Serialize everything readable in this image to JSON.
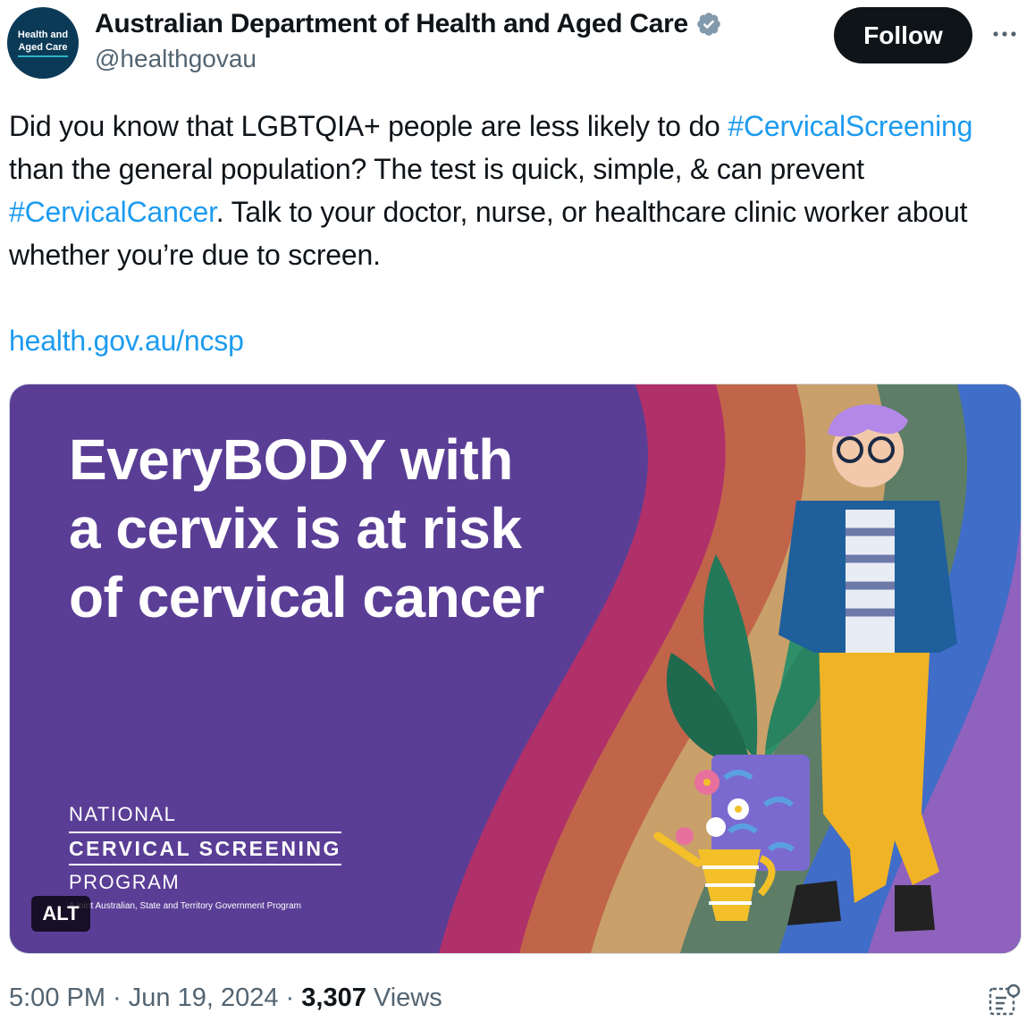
{
  "header": {
    "avatar_line1": "Health and",
    "avatar_line2": "Aged Care",
    "display_name": "Australian Department of Health and Aged Care",
    "handle": "@healthgovau",
    "follow_label": "Follow",
    "verified_icon": "verified-badge-icon",
    "more_icon": "more-options-icon"
  },
  "tweet": {
    "seg1": "Did you know that LGBTQIA+ people are less likely to do ",
    "hashtag1": "#CervicalScreening",
    "seg2": " than the general population? The test is quick, simple, & can prevent ",
    "hashtag2": "#CervicalCancer",
    "seg3": ". Talk to your doctor, nurse, or healthcare clinic worker about whether you’re due to screen.",
    "url": "health.gov.au/ncsp"
  },
  "media": {
    "headline_line1": "EveryBODY with",
    "headline_line2": "a cervix is at risk",
    "headline_line3": "of cervical cancer",
    "logo_line1": "NATIONAL",
    "logo_line2": "CERVICAL SCREENING",
    "logo_line3": "PROGRAM",
    "logo_line4": "A joint Australian, State and Territory Government Program",
    "alt_label": "ALT",
    "colors": {
      "background": "#5a3e96",
      "bands": [
        "#b0306a",
        "#c0644a",
        "#c9a06a",
        "#5d7d67",
        "#3f6dc8",
        "#8e62bd"
      ]
    }
  },
  "meta": {
    "time": "5:00 PM",
    "sep1": " · ",
    "date": "Jun 19, 2024",
    "sep2": " · ",
    "views_count": "3,307",
    "views_label": " Views",
    "summary_icon": "grok-summary-icon"
  }
}
